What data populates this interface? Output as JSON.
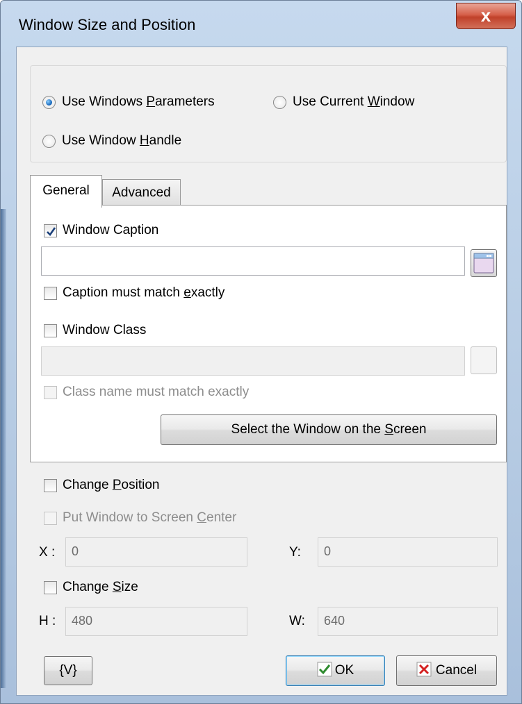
{
  "window": {
    "title": "Window Size and Position",
    "close_glyph": "x"
  },
  "mode": {
    "options": [
      {
        "label_pre": "Use Windows ",
        "label_key": "P",
        "label_post": "arameters",
        "selected": true
      },
      {
        "label_pre": "Use Current ",
        "label_key": "W",
        "label_post": "indow",
        "selected": false
      },
      {
        "label_pre": "Use Window ",
        "label_key": "H",
        "label_post": "andle",
        "selected": false
      }
    ]
  },
  "tabs": [
    {
      "label": "General",
      "active": true
    },
    {
      "label": "Advanced",
      "active": false
    }
  ],
  "general": {
    "window_caption": {
      "label": "Window Caption",
      "checked": true,
      "value": ""
    },
    "caption_exact": {
      "label_pre": "Caption must match ",
      "label_key": "e",
      "label_post": "xactly",
      "checked": false
    },
    "window_class": {
      "label": "Window Class",
      "checked": false,
      "value": ""
    },
    "class_exact": {
      "label": "Class name must match exactly",
      "checked": false,
      "enabled": false
    },
    "select_button": {
      "label_pre": "Select the Window on the ",
      "label_key": "S",
      "label_post": "creen"
    }
  },
  "position": {
    "change_position": {
      "label_pre": "Change ",
      "label_key": "P",
      "label_post": "osition",
      "checked": false
    },
    "center": {
      "label_pre": "Put Window to Screen ",
      "label_key": "C",
      "label_post": "enter",
      "checked": false,
      "enabled": false
    },
    "x": {
      "label": "X :",
      "value": "0"
    },
    "y": {
      "label": "Y:",
      "value": "0"
    }
  },
  "size": {
    "change_size": {
      "label_pre": "Change ",
      "label_key": "S",
      "label_post": "ize",
      "checked": false
    },
    "h": {
      "label": "H :",
      "value": "480"
    },
    "w": {
      "label": "W:",
      "value": "640"
    }
  },
  "footer": {
    "variables_button": "{V}",
    "ok_button": "OK",
    "cancel_button": "Cancel"
  },
  "colors": {
    "accent": "#1f6fc0",
    "ok_check": "#2e8b2e",
    "cancel_x": "#d42020",
    "close_button": "#c9503a"
  }
}
